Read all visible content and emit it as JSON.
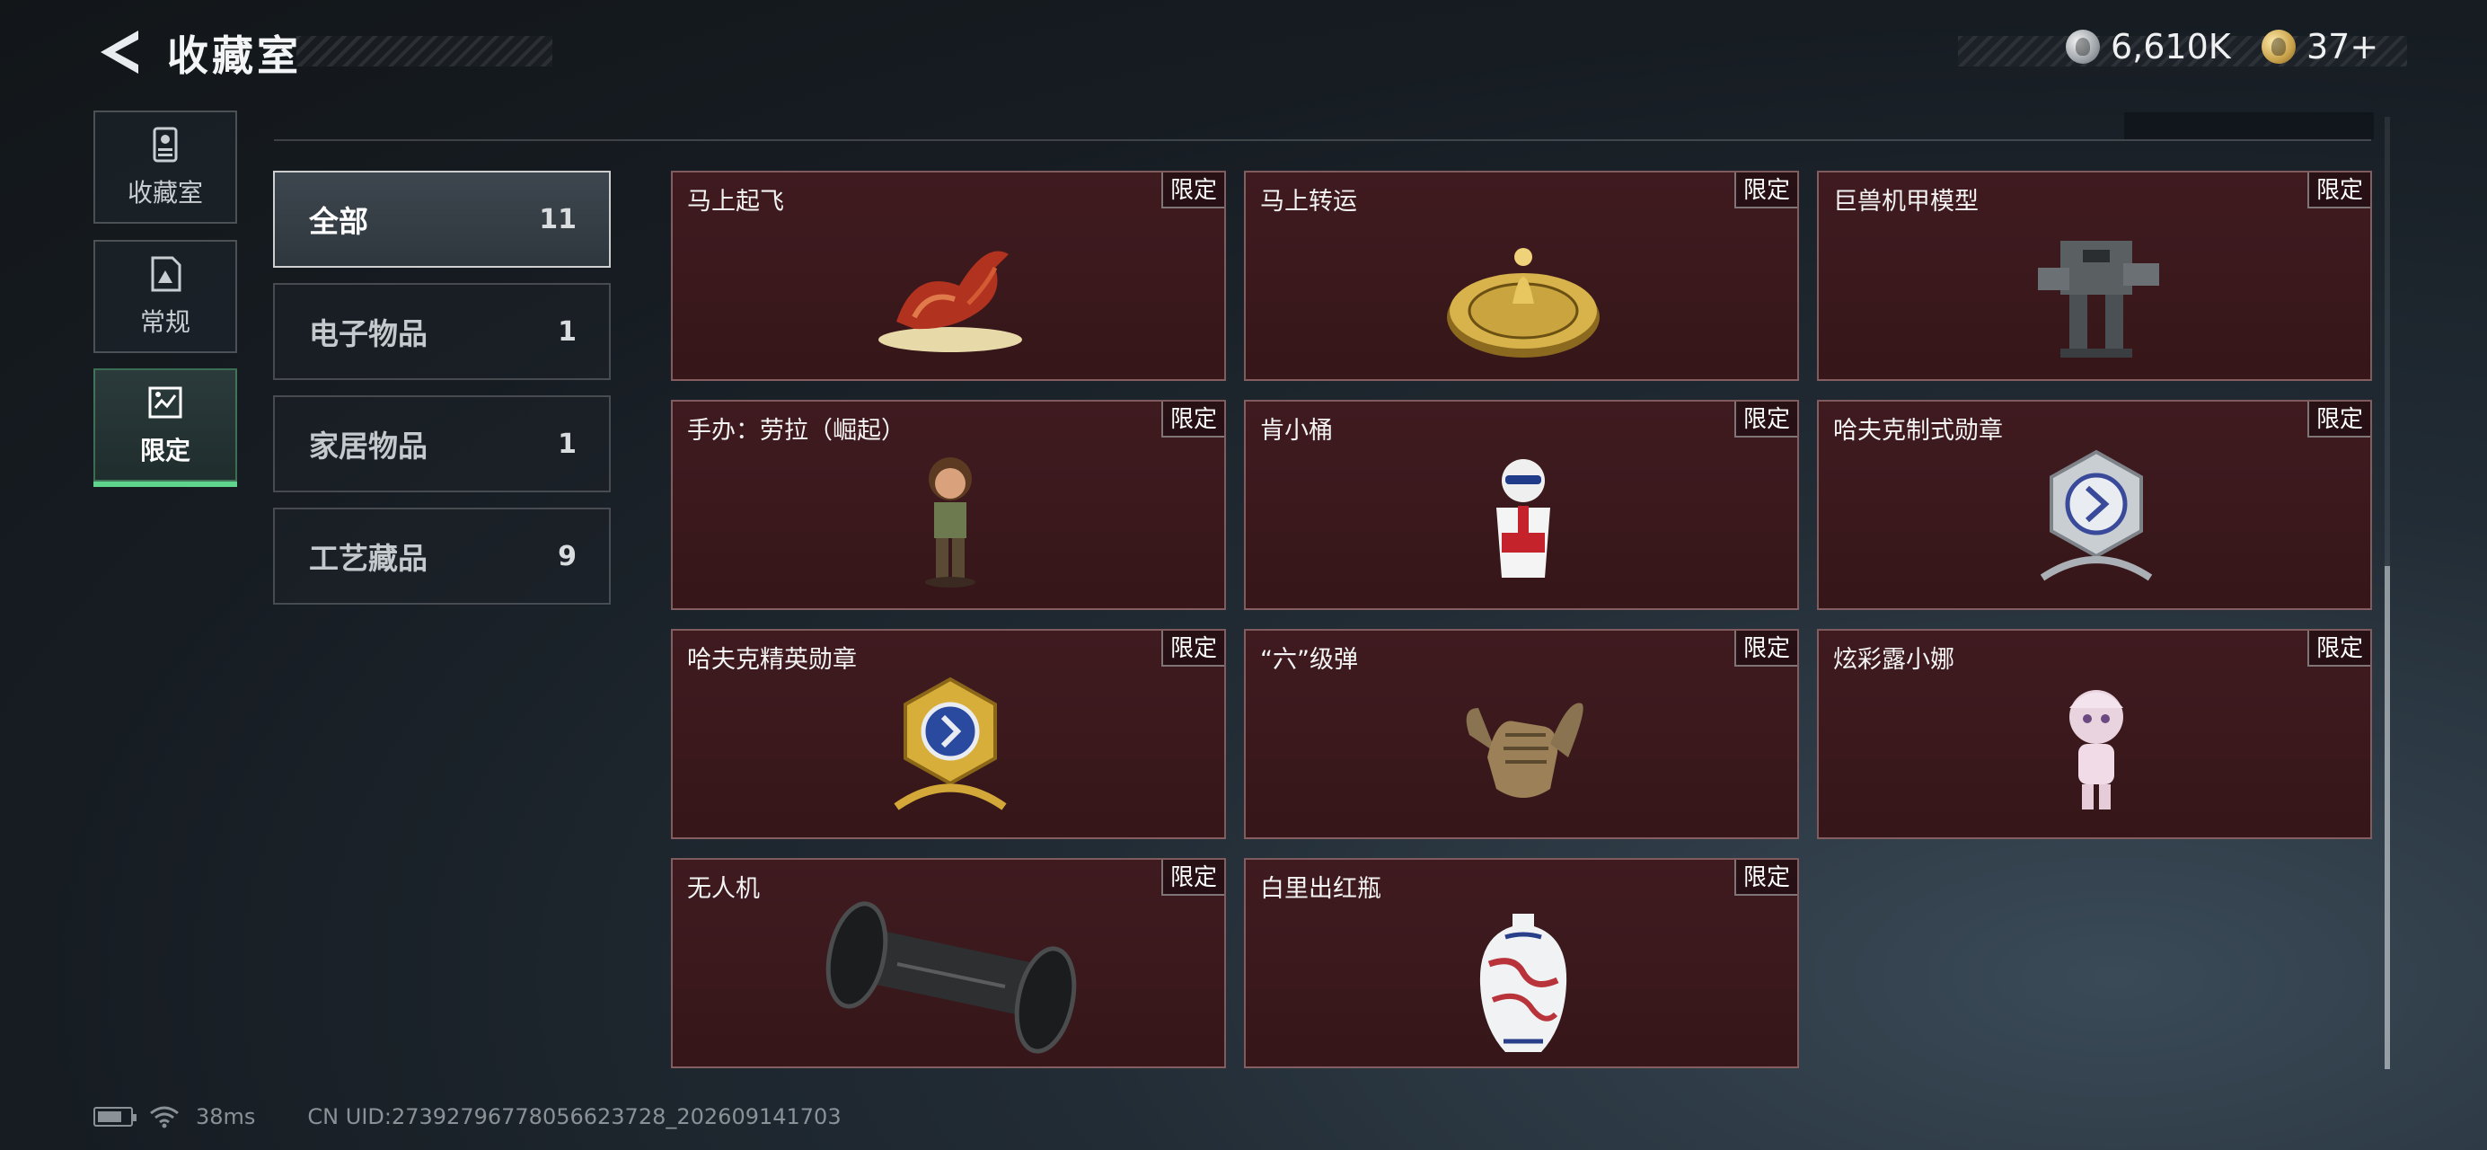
{
  "header": {
    "title": "收藏室",
    "currencies": [
      {
        "icon": "silver-coin-icon",
        "value": "6,610K"
      },
      {
        "icon": "gold-coin-icon",
        "value": "37+"
      }
    ]
  },
  "nav": {
    "items": [
      {
        "label": "收藏室",
        "icon": "collection-room-icon",
        "active": false
      },
      {
        "label": "常规",
        "icon": "regular-icon",
        "active": false
      },
      {
        "label": "限定",
        "icon": "limited-icon",
        "active": true
      }
    ]
  },
  "categories": [
    {
      "label": "全部",
      "count": "11",
      "active": true
    },
    {
      "label": "电子物品",
      "count": "1",
      "active": false
    },
    {
      "label": "家居物品",
      "count": "1",
      "active": false
    },
    {
      "label": "工艺藏品",
      "count": "9",
      "active": false
    }
  ],
  "items": [
    {
      "name": "马上起飞",
      "badge": "限定",
      "icon": "horse-sculpture-icon"
    },
    {
      "name": "马上转运",
      "badge": "限定",
      "icon": "golden-wheel-icon"
    },
    {
      "name": "巨兽机甲模型",
      "badge": "限定",
      "icon": "mech-model-icon"
    },
    {
      "name": "手办：劳拉（崛起）",
      "badge": "限定",
      "icon": "figure-icon"
    },
    {
      "name": "肯小桶",
      "badge": "限定",
      "icon": "bucket-figure-icon"
    },
    {
      "name": "哈夫克制式勋章",
      "badge": "限定",
      "icon": "silver-medal-icon"
    },
    {
      "name": "哈夫克精英勋章",
      "badge": "限定",
      "icon": "gold-medal-icon"
    },
    {
      "name": "“六”级弹",
      "badge": "限定",
      "icon": "hand-sculpture-icon"
    },
    {
      "name": "炫彩露小娜",
      "badge": "限定",
      "icon": "doll-figure-icon"
    },
    {
      "name": "无人机",
      "badge": "限定",
      "icon": "drone-roller-icon"
    },
    {
      "name": "白里出红瓶",
      "badge": "限定",
      "icon": "porcelain-vase-icon"
    }
  ],
  "footer": {
    "ping": "38ms",
    "uid": "CN UID:27392796778056623728_202609141703"
  },
  "colors": {
    "card_bg": "#3f1b20",
    "active_accent": "#5fd48d",
    "page_bg": "#161c22"
  }
}
